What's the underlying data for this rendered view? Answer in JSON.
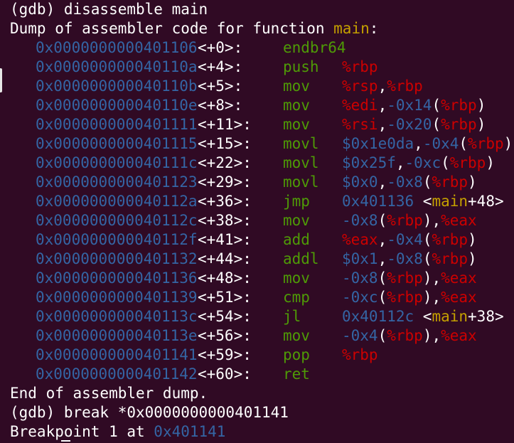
{
  "terminal": {
    "cmd1": "(gdb) disassemble main",
    "dump_prefix": "Dump of assembler code for function ",
    "func_name": "main",
    "dump_suffix": ":",
    "rows": [
      {
        "addr": "0x0000000000401106",
        "off": "<+0>:",
        "mn": "endbr64",
        "ops": []
      },
      {
        "addr": "0x000000000040110a",
        "off": "<+4>:",
        "mn": "push",
        "ops": [
          [
            "reg",
            "%rbp"
          ]
        ]
      },
      {
        "addr": "0x000000000040110b",
        "off": "<+5>:",
        "mn": "mov",
        "ops": [
          [
            "reg",
            "%rsp"
          ],
          [
            "pun",
            ","
          ],
          [
            "reg",
            "%rbp"
          ]
        ]
      },
      {
        "addr": "0x000000000040110e",
        "off": "<+8>:",
        "mn": "mov",
        "ops": [
          [
            "reg",
            "%edi"
          ],
          [
            "pun",
            ","
          ],
          [
            "num",
            "-0x14"
          ],
          [
            "pun",
            "("
          ],
          [
            "reg",
            "%rbp"
          ],
          [
            "pun",
            ")"
          ]
        ]
      },
      {
        "addr": "0x0000000000401111",
        "off": "<+11>:",
        "mn": "mov",
        "ops": [
          [
            "reg",
            "%rsi"
          ],
          [
            "pun",
            ","
          ],
          [
            "num",
            "-0x20"
          ],
          [
            "pun",
            "("
          ],
          [
            "reg",
            "%rbp"
          ],
          [
            "pun",
            ")"
          ]
        ]
      },
      {
        "addr": "0x0000000000401115",
        "off": "<+15>:",
        "mn": "movl",
        "ops": [
          [
            "num",
            "$0x1e0da"
          ],
          [
            "pun",
            ","
          ],
          [
            "num",
            "-0x4"
          ],
          [
            "pun",
            "("
          ],
          [
            "reg",
            "%rbp"
          ],
          [
            "pun",
            ")"
          ]
        ]
      },
      {
        "addr": "0x000000000040111c",
        "off": "<+22>:",
        "mn": "movl",
        "ops": [
          [
            "num",
            "$0x25f"
          ],
          [
            "pun",
            ","
          ],
          [
            "num",
            "-0xc"
          ],
          [
            "pun",
            "("
          ],
          [
            "reg",
            "%rbp"
          ],
          [
            "pun",
            ")"
          ]
        ]
      },
      {
        "addr": "0x0000000000401123",
        "off": "<+29>:",
        "mn": "movl",
        "ops": [
          [
            "num",
            "$0x0"
          ],
          [
            "pun",
            ","
          ],
          [
            "num",
            "-0x8"
          ],
          [
            "pun",
            "("
          ],
          [
            "reg",
            "%rbp"
          ],
          [
            "pun",
            ")"
          ]
        ]
      },
      {
        "addr": "0x000000000040112a",
        "off": "<+36>:",
        "mn": "jmp",
        "ops": [
          [
            "num",
            "0x401136"
          ],
          [
            "pun",
            " <"
          ],
          [
            "sym",
            "main"
          ],
          [
            "pun",
            "+48>"
          ]
        ]
      },
      {
        "addr": "0x000000000040112c",
        "off": "<+38>:",
        "mn": "mov",
        "ops": [
          [
            "num",
            "-0x8"
          ],
          [
            "pun",
            "("
          ],
          [
            "reg",
            "%rbp"
          ],
          [
            "pun",
            "),"
          ],
          [
            "reg",
            "%eax"
          ]
        ]
      },
      {
        "addr": "0x000000000040112f",
        "off": "<+41>:",
        "mn": "add",
        "ops": [
          [
            "reg",
            "%eax"
          ],
          [
            "pun",
            ","
          ],
          [
            "num",
            "-0x4"
          ],
          [
            "pun",
            "("
          ],
          [
            "reg",
            "%rbp"
          ],
          [
            "pun",
            ")"
          ]
        ]
      },
      {
        "addr": "0x0000000000401132",
        "off": "<+44>:",
        "mn": "addl",
        "ops": [
          [
            "num",
            "$0x1"
          ],
          [
            "pun",
            ","
          ],
          [
            "num",
            "-0x8"
          ],
          [
            "pun",
            "("
          ],
          [
            "reg",
            "%rbp"
          ],
          [
            "pun",
            ")"
          ]
        ]
      },
      {
        "addr": "0x0000000000401136",
        "off": "<+48>:",
        "mn": "mov",
        "ops": [
          [
            "num",
            "-0x8"
          ],
          [
            "pun",
            "("
          ],
          [
            "reg",
            "%rbp"
          ],
          [
            "pun",
            "),"
          ],
          [
            "reg",
            "%eax"
          ]
        ]
      },
      {
        "addr": "0x0000000000401139",
        "off": "<+51>:",
        "mn": "cmp",
        "ops": [
          [
            "num",
            "-0xc"
          ],
          [
            "pun",
            "("
          ],
          [
            "reg",
            "%rbp"
          ],
          [
            "pun",
            "),"
          ],
          [
            "reg",
            "%eax"
          ]
        ]
      },
      {
        "addr": "0x000000000040113c",
        "off": "<+54>:",
        "mn": "jl",
        "ops": [
          [
            "num",
            "0x40112c"
          ],
          [
            "pun",
            " <"
          ],
          [
            "sym",
            "main"
          ],
          [
            "pun",
            "+38>"
          ]
        ]
      },
      {
        "addr": "0x000000000040113e",
        "off": "<+56>:",
        "mn": "mov",
        "ops": [
          [
            "num",
            "-0x4"
          ],
          [
            "pun",
            "("
          ],
          [
            "reg",
            "%rbp"
          ],
          [
            "pun",
            "),"
          ],
          [
            "reg",
            "%eax"
          ]
        ]
      },
      {
        "addr": "0x0000000000401141",
        "off": "<+59>:",
        "mn": "pop",
        "ops": [
          [
            "reg",
            "%rbp"
          ]
        ]
      },
      {
        "addr": "0x0000000000401142",
        "off": "<+60>:",
        "mn": "ret",
        "ops": []
      }
    ],
    "end_line": "End of assembler dump.",
    "cmd2": "(gdb) break *0x0000000000401141",
    "bp_prefix": "Breakpoint 1 at ",
    "bp_addr": "0x401141",
    "colors": {
      "background": "#300a24",
      "address": "#3465a4",
      "mnemonic": "#4e9a06",
      "register": "#cc0000",
      "symbol": "#c4a000",
      "text": "#ffffff"
    }
  }
}
